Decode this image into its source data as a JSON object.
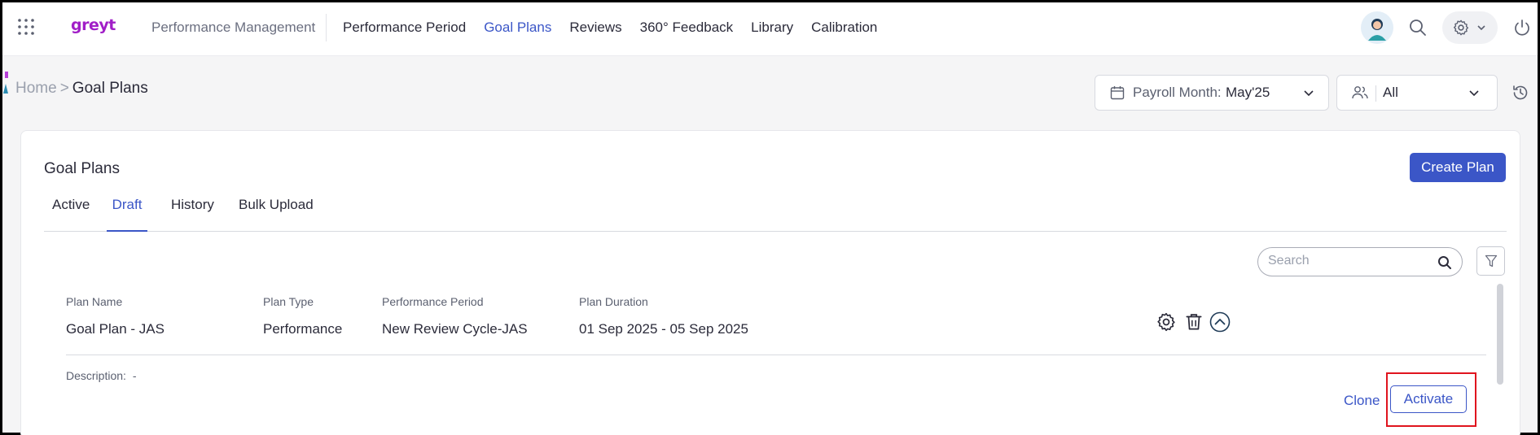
{
  "topbar": {
    "logo": "greyt",
    "module": "Performance Management",
    "nav": [
      "Performance Period",
      "Goal Plans",
      "Reviews",
      "360° Feedback",
      "Library",
      "Calibration"
    ],
    "active_nav": "Goal Plans"
  },
  "breadcrumb": {
    "home": "Home",
    "sep": ">",
    "current": "Goal Plans"
  },
  "filters": {
    "payroll_label": "Payroll Month:",
    "payroll_value": "May'25",
    "people_value": "All"
  },
  "card": {
    "title": "Goal Plans",
    "create_label": "Create Plan",
    "tabs": [
      "Active",
      "Draft",
      "History",
      "Bulk Upload"
    ],
    "active_tab": "Draft",
    "search_placeholder": "Search"
  },
  "table": {
    "headers": [
      "Plan Name",
      "Plan Type",
      "Performance Period",
      "Plan Duration"
    ],
    "row": {
      "plan_name": "Goal Plan - JAS",
      "plan_type": "Performance",
      "performance_period": "New Review Cycle-JAS",
      "plan_duration": "01 Sep 2025 - 05 Sep 2025",
      "description_label": "Description:",
      "description_value": "-"
    }
  },
  "actions": {
    "clone": "Clone",
    "activate": "Activate"
  },
  "colors": {
    "accent": "#3b56c7",
    "highlight": "#e0141e",
    "logo": "#a11ec7"
  },
  "icons": [
    "apps-grid-icon",
    "search-icon",
    "gear-icon",
    "chevron-down-icon",
    "power-icon",
    "calendar-icon",
    "people-icon",
    "history-icon",
    "filter-icon",
    "trash-icon",
    "chevron-up-circle-icon"
  ]
}
